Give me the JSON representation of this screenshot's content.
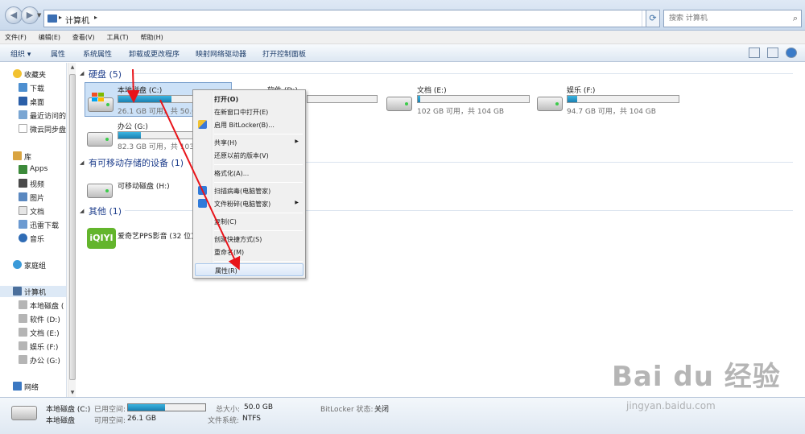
{
  "address_bar": {
    "path_root_sep": "▸",
    "path_label": "计算机",
    "path_sep": "▸",
    "search_placeholder": "搜索 计算机"
  },
  "menu": [
    "文件(F)",
    "编辑(E)",
    "查看(V)",
    "工具(T)",
    "帮助(H)"
  ],
  "commands": {
    "organize": "组织 ▾",
    "properties": "属性",
    "system_properties": "系统属性",
    "uninstall": "卸载或更改程序",
    "map_drive": "映射网络驱动器",
    "control_panel": "打开控制面板"
  },
  "sidebar": {
    "favorites": "收藏夹",
    "downloads": "下载",
    "desktop": "桌面",
    "recent": "最近访问的",
    "weiyun": "微云同步盘",
    "libraries": "库",
    "apps": "Apps",
    "video": "视频",
    "pictures": "图片",
    "documents": "文档",
    "xunlei": "迅雷下载",
    "music": "音乐",
    "homegroup": "家庭组",
    "computer": "计算机",
    "drive_c": "本地磁盘 (",
    "drive_d": "软件 (D:)",
    "drive_e": "文档 (E:)",
    "drive_f": "娱乐 (F:)",
    "drive_g": "办公 (G:)",
    "network": "网络"
  },
  "groups": {
    "hdd": "硬盘 (5)",
    "removable": "有可移动存储的设备 (1)",
    "other": "其他 (1)"
  },
  "drives": [
    {
      "name": "本地磁盘 (C:)",
      "info": "26.1 GB 可用，共 50.0",
      "used_fraction": 0.48
    },
    {
      "name": "软件 (D:)",
      "info": "",
      "used_fraction": 0.0
    },
    {
      "name": "文档 (E:)",
      "info": "102 GB 可用，共 104 GB",
      "used_fraction": 0.02
    },
    {
      "name": "娱乐 (F:)",
      "info": "94.7 GB 可用，共 104 GB",
      "used_fraction": 0.09
    },
    {
      "name": "办公 (G:)",
      "info": "82.3 GB 可用，共 103",
      "used_fraction": 0.2
    }
  ],
  "removable": {
    "name": "可移动磁盘 (H:)"
  },
  "other": {
    "name": "爱奇艺PPS影音 (32 位)",
    "icon_text": "iQIYI"
  },
  "context_menu": {
    "open": "打开(O)",
    "open_new_window": "在新窗口中打开(E)",
    "bitlocker": "启用 BitLocker(B)...",
    "share": "共享(H)",
    "restore": "还原以前的版本(V)",
    "format": "格式化(A)...",
    "scan": "扫描病毒(电脑管家)",
    "shred": "文件粉碎(电脑管家)",
    "copy": "复制(C)",
    "shortcut": "创建快捷方式(S)",
    "rename": "重命名(M)",
    "properties": "属性(R)"
  },
  "details": {
    "drive_name": "本地磁盘 (C:)",
    "drive_type": "本地磁盘",
    "used_label": "已用空间:",
    "free_label": "可用空间:",
    "free_value": "26.1 GB",
    "total_label": "总大小:",
    "total_value": "50.0 GB",
    "fs_label": "文件系统:",
    "fs_value": "NTFS",
    "bitlocker_label": "BitLocker 状态:",
    "bitlocker_value": "关闭",
    "used_fraction": 0.48
  },
  "watermark": {
    "logo": "Bai du 经验",
    "url": "jingyan.baidu.com"
  },
  "colors": {
    "group_heading": "#1e3e8c",
    "selection": "#cce1f7",
    "bar_fill": "#2a9fd0",
    "annotation": "#e8141a"
  }
}
